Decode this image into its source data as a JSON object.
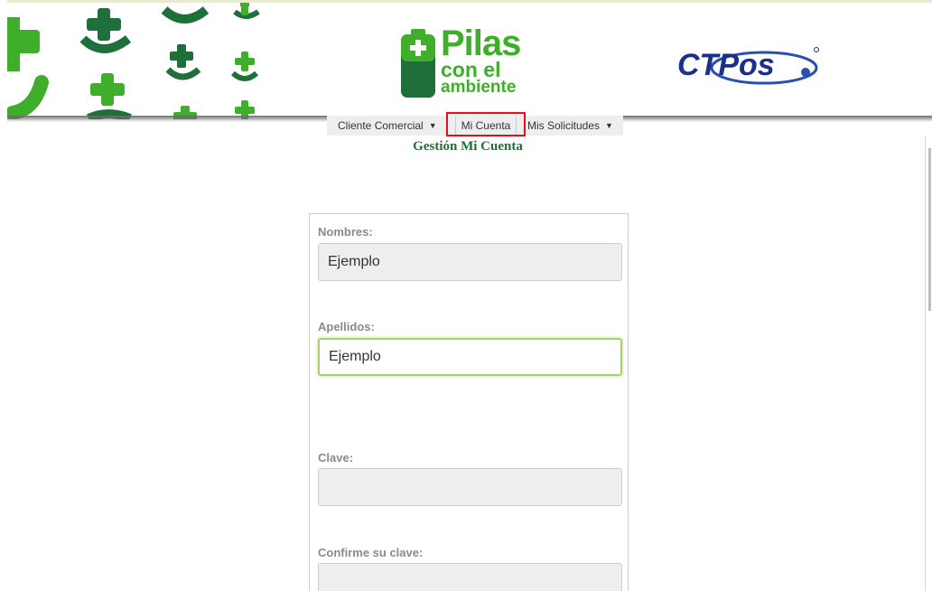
{
  "header": {
    "brand": {
      "line1": "Pilas",
      "line2": "con el",
      "line3": "ambiente"
    },
    "partner_logo": "CTPos",
    "colors": {
      "brand_green": "#3fae2a",
      "dark_green": "#1e6f3a",
      "partner_blue": "#1b2f8f"
    }
  },
  "nav": {
    "items": [
      {
        "label": "Cliente Comercial",
        "has_dropdown": true
      },
      {
        "label": "Mi Cuenta",
        "has_dropdown": false,
        "highlighted": true
      },
      {
        "label": "Mis Solicitudes",
        "has_dropdown": true
      }
    ],
    "caret_icon": "caret-down-icon"
  },
  "page": {
    "title": "Gestión Mi Cuenta"
  },
  "form": {
    "nombres": {
      "label": "Nombres:",
      "value": "Ejemplo"
    },
    "apellidos": {
      "label": "Apellidos:",
      "value": "Ejemplo"
    },
    "clave": {
      "label": "Clave:",
      "value": ""
    },
    "confirme_clave": {
      "label": "Confirme su clave:",
      "value": ""
    }
  }
}
